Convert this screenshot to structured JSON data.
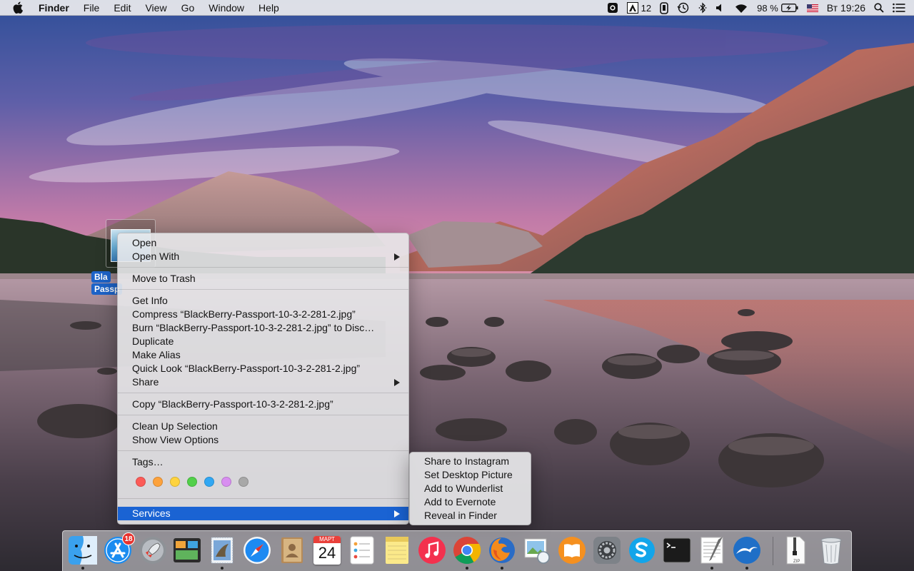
{
  "menubar": {
    "app_name": "Finder",
    "menus": [
      "File",
      "Edit",
      "View",
      "Go",
      "Window",
      "Help"
    ],
    "status": {
      "notification_count": "12",
      "battery": "98 %",
      "clock": "Вт 19:26"
    }
  },
  "desktop_icon": {
    "label_line1": "Bla",
    "label_line2": "Passp"
  },
  "context_menu": {
    "open": "Open",
    "open_with": "Open With",
    "move_to_trash": "Move to Trash",
    "get_info": "Get Info",
    "compress": "Compress “BlackBerry-Passport-10-3-2-281-2.jpg”",
    "burn": "Burn “BlackBerry-Passport-10-3-2-281-2.jpg” to Disc…",
    "duplicate": "Duplicate",
    "make_alias": "Make Alias",
    "quick_look": "Quick Look “BlackBerry-Passport-10-3-2-281-2.jpg”",
    "share": "Share",
    "copy": "Copy “BlackBerry-Passport-10-3-2-281-2.jpg”",
    "clean_up": "Clean Up Selection",
    "show_view_options": "Show View Options",
    "tags": "Tags…",
    "tag_colors": [
      "#fc5b57",
      "#fda23c",
      "#fed33e",
      "#52d04a",
      "#31a7f3",
      "#d88ef0",
      "#a8a8a8"
    ],
    "services": "Services"
  },
  "services_submenu": {
    "items": [
      "Share to Instagram",
      "Set Desktop Picture",
      "Add to Wunderlist",
      "Add to Evernote",
      "Reveal in Finder"
    ]
  },
  "dock": {
    "app_store_badge": "18",
    "calendar_month": "МАРТ",
    "calendar_day": "24",
    "zip_label": "ZIP"
  },
  "colors": {
    "selection": "#1a63d3",
    "menubar_bg": "#ececee"
  }
}
